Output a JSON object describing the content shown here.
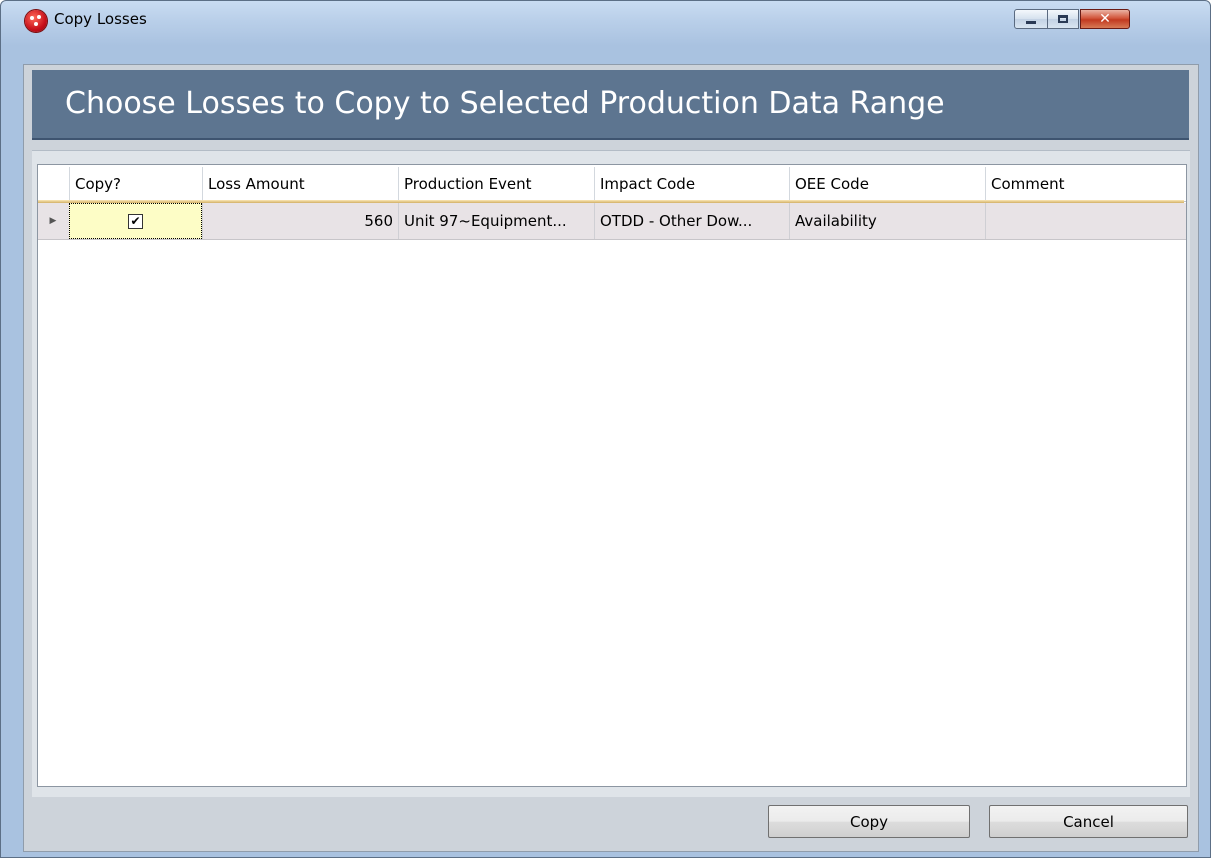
{
  "window": {
    "title": "Copy Losses",
    "icon": "app-logo-icon",
    "caption_buttons": [
      "minimize-icon",
      "maximize-icon",
      "close-icon"
    ],
    "close_glyph": "✕"
  },
  "banner": {
    "text": "Choose Losses to Copy to Selected Production Data Range"
  },
  "grid": {
    "columns": [
      "Copy?",
      "Loss Amount",
      "Production Event",
      "Impact Code",
      "OEE Code",
      "Comment"
    ],
    "rows": [
      {
        "indicator": "▶",
        "copy_checked": true,
        "check_glyph": "✔",
        "loss_amount": "560",
        "production_event": "Unit 97~Equipment...",
        "impact_code": "OTDD - Other Dow...",
        "oee_code": "Availability",
        "comment": ""
      }
    ]
  },
  "buttons": {
    "copy": "Copy",
    "cancel": "Cancel"
  },
  "colors": {
    "banner": "#5d7590",
    "selected_cell": "#fdfdc6",
    "row_background": "#e8e3e6"
  }
}
